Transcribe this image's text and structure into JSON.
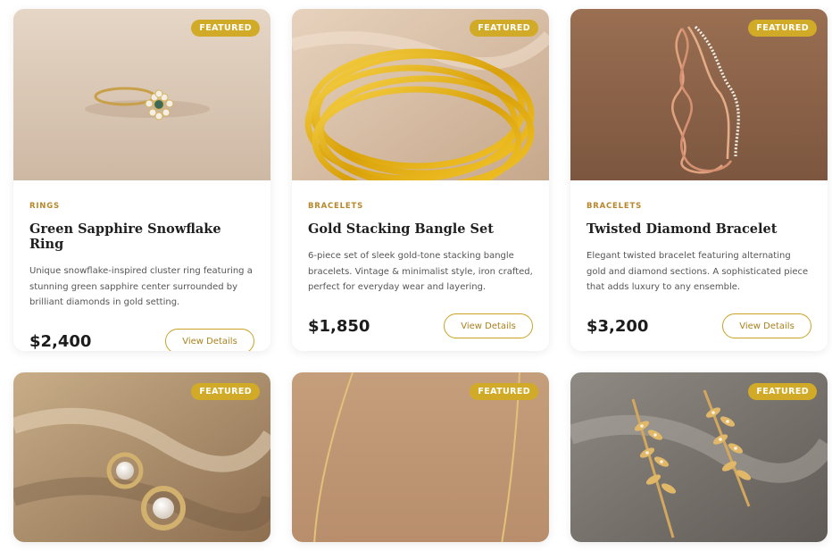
{
  "products": [
    {
      "badge": "FEATURED",
      "category": "RINGS",
      "title": "Green Sapphire Snowflake Ring",
      "description": "Unique snowflake-inspired cluster ring featuring a stunning green sapphire center surrounded by brilliant diamonds in gold setting.",
      "price": "$2,400",
      "button": "View Details"
    },
    {
      "badge": "FEATURED",
      "category": "BRACELETS",
      "title": "Gold Stacking Bangle Set",
      "description": "6-piece set of sleek gold-tone stacking bangle bracelets. Vintage & minimalist style, iron crafted, perfect for everyday wear and layering.",
      "price": "$1,850",
      "button": "View Details"
    },
    {
      "badge": "FEATURED",
      "category": "BRACELETS",
      "title": "Twisted Diamond Bracelet",
      "description": "Elegant twisted bracelet featuring alternating gold and diamond sections. A sophisticated piece that adds luxury to any ensemble.",
      "price": "$3,200",
      "button": "View Details"
    },
    {
      "badge": "FEATURED"
    },
    {
      "badge": "FEATURED"
    },
    {
      "badge": "FEATURED"
    }
  ],
  "colors": {
    "accent": "#d1ab28",
    "category": "#b8862a",
    "button_border": "#c9a227"
  }
}
